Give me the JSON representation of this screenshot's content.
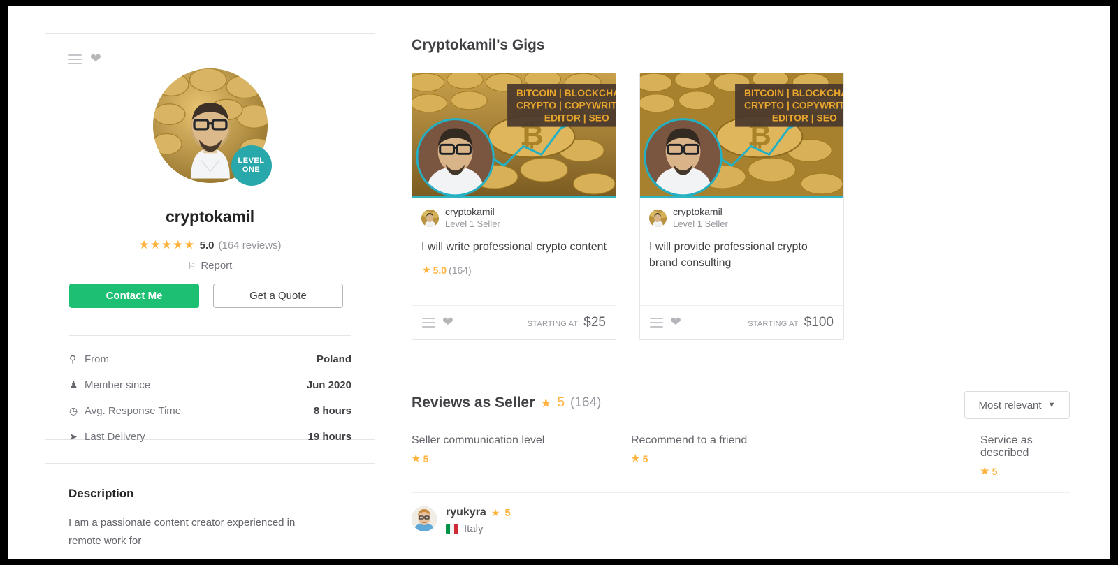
{
  "profile": {
    "menu_icon": "hamburger-icon",
    "favorite_icon": "heart-icon",
    "username": "cryptokamil",
    "level_badge_line1": "LEVEL",
    "level_badge_line2": "ONE",
    "stars": "★★★★★",
    "rating_score": "5.0",
    "rating_count": "(164 reviews)",
    "report_label": "Report",
    "report_icon": "flag-icon",
    "contact_button": "Contact Me",
    "quote_button": "Get a Quote",
    "stats": [
      {
        "icon": "location-pin-icon",
        "glyph": "⚲",
        "label": "From",
        "value": "Poland"
      },
      {
        "icon": "person-icon",
        "glyph": "♟",
        "label": "Member since",
        "value": "Jun 2020"
      },
      {
        "icon": "clock-icon",
        "glyph": "◷",
        "label": "Avg. Response Time",
        "value": "8 hours"
      },
      {
        "icon": "send-icon",
        "glyph": "➤",
        "label": "Last Delivery",
        "value": "19 hours"
      }
    ]
  },
  "description": {
    "title": "Description",
    "body": "I am a passionate content creator experienced in remote work for"
  },
  "gigs_section": {
    "heading": "Cryptokamil's Gigs",
    "thumb_banner": {
      "line1": "BITCOIN | BLOCKCHAIN",
      "line2": "CRYPTO | COPYWRITER",
      "line3": "EDITOR | SEO"
    },
    "gigs": [
      {
        "seller_name": "cryptokamil",
        "seller_level": "Level 1 Seller",
        "title": "I will write professional crypto content",
        "rating_score": "5.0",
        "rating_count": "(164)",
        "has_rating": true,
        "starting_at_label": "Starting at",
        "price": "$25"
      },
      {
        "seller_name": "cryptokamil",
        "seller_level": "Level 1 Seller",
        "title": "I will provide professional crypto brand consulting",
        "rating_score": "",
        "rating_count": "",
        "has_rating": false,
        "starting_at_label": "Starting at",
        "price": "$100"
      }
    ]
  },
  "reviews_section": {
    "heading": "Reviews as Seller",
    "heading_score": "5",
    "heading_count": "(164)",
    "sort_value": "Most relevant",
    "breakdown": [
      {
        "label": "Seller communication level",
        "value": "5"
      },
      {
        "label": "Recommend to a friend",
        "value": "5"
      },
      {
        "label": "Service as described",
        "value": "5"
      }
    ],
    "reviews": [
      {
        "name": "ryukyra",
        "score": "5",
        "country": "Italy"
      }
    ]
  },
  "colors": {
    "brand_green": "#1dbf73",
    "badge_teal": "#29a8ac",
    "star_yellow": "#ffb33e",
    "text_dark": "#404145",
    "text_muted": "#74767e"
  }
}
